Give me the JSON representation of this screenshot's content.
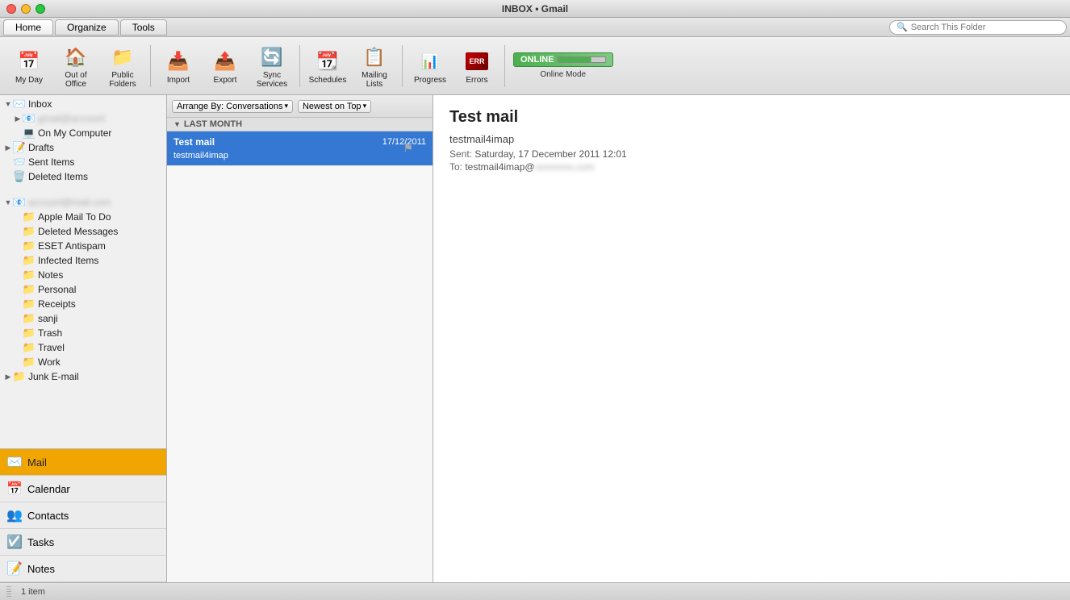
{
  "titleBar": {
    "title": "INBOX • Gmail"
  },
  "tabs": {
    "items": [
      "Home",
      "Organize",
      "Tools"
    ],
    "active": "Home"
  },
  "ribbon": {
    "buttons": [
      {
        "id": "my-day",
        "label": "My Day",
        "icon": "📅"
      },
      {
        "id": "out-of-office",
        "label": "Out of Office",
        "icon": "🏠"
      },
      {
        "id": "public-folders",
        "label": "Public Folders",
        "icon": "📁"
      },
      {
        "id": "import",
        "label": "Import",
        "icon": "📥"
      },
      {
        "id": "export",
        "label": "Export",
        "icon": "📤"
      },
      {
        "id": "sync-services",
        "label": "Sync Services",
        "icon": "🔄"
      },
      {
        "id": "schedules",
        "label": "Schedules",
        "icon": "📆"
      },
      {
        "id": "mailing-lists",
        "label": "Mailing Lists",
        "icon": "📋"
      },
      {
        "id": "progress",
        "label": "Progress",
        "icon": "📊"
      },
      {
        "id": "errors",
        "label": "Errors",
        "icon": "🖥️"
      }
    ],
    "onlineMode": {
      "label": "Online Mode",
      "status": "ONLINE"
    }
  },
  "sidebar": {
    "tree": [
      {
        "id": "inbox",
        "label": "Inbox",
        "level": 0,
        "expanded": true,
        "icon": "✉️",
        "hasArrow": true
      },
      {
        "id": "gmail-account",
        "label": "",
        "level": 1,
        "expanded": false,
        "icon": "📧",
        "hasArrow": true,
        "blurred": true
      },
      {
        "id": "on-my-computer",
        "label": "On My Computer",
        "level": 1,
        "expanded": false,
        "icon": "💻",
        "hasArrow": false
      },
      {
        "id": "drafts",
        "label": "Drafts",
        "level": 0,
        "expanded": false,
        "icon": "📝",
        "hasArrow": true
      },
      {
        "id": "sent-items",
        "label": "Sent Items",
        "level": 0,
        "expanded": false,
        "icon": "📨",
        "hasArrow": false
      },
      {
        "id": "deleted-items",
        "label": "Deleted Items",
        "level": 0,
        "expanded": false,
        "icon": "🗑️",
        "hasArrow": false
      },
      {
        "id": "spacer",
        "label": "",
        "level": 0,
        "expanded": false,
        "icon": "",
        "hasArrow": false,
        "spacer": true
      },
      {
        "id": "account2",
        "label": "",
        "level": 0,
        "expanded": true,
        "icon": "📧",
        "hasArrow": true,
        "blurred": true
      },
      {
        "id": "apple-mail",
        "label": "Apple Mail To Do",
        "level": 1,
        "expanded": false,
        "icon": "📁",
        "hasArrow": false
      },
      {
        "id": "deleted-messages",
        "label": "Deleted Messages",
        "level": 1,
        "expanded": false,
        "icon": "📁",
        "hasArrow": false
      },
      {
        "id": "eset-antispam",
        "label": "ESET Antispam",
        "level": 1,
        "expanded": false,
        "icon": "📁",
        "hasArrow": false
      },
      {
        "id": "infected-items",
        "label": "Infected Items",
        "level": 1,
        "expanded": false,
        "icon": "📁",
        "hasArrow": false
      },
      {
        "id": "notes",
        "label": "Notes",
        "level": 1,
        "expanded": false,
        "icon": "📁",
        "hasArrow": false
      },
      {
        "id": "personal",
        "label": "Personal",
        "level": 1,
        "expanded": false,
        "icon": "📁",
        "hasArrow": false
      },
      {
        "id": "receipts",
        "label": "Receipts",
        "level": 1,
        "expanded": false,
        "icon": "📁",
        "hasArrow": false
      },
      {
        "id": "sanji",
        "label": "sanji",
        "level": 1,
        "expanded": false,
        "icon": "📁",
        "hasArrow": false
      },
      {
        "id": "trash",
        "label": "Trash",
        "level": 1,
        "expanded": false,
        "icon": "📁",
        "hasArrow": false
      },
      {
        "id": "travel",
        "label": "Travel",
        "level": 1,
        "expanded": false,
        "icon": "📁",
        "hasArrow": false
      },
      {
        "id": "work",
        "label": "Work",
        "level": 1,
        "expanded": false,
        "icon": "📁",
        "hasArrow": false
      },
      {
        "id": "junk-email",
        "label": "Junk E-mail",
        "level": 0,
        "expanded": false,
        "icon": "📁",
        "hasArrow": true
      }
    ]
  },
  "navBar": {
    "items": [
      {
        "id": "mail",
        "label": "Mail",
        "icon": "✉️",
        "active": true
      },
      {
        "id": "calendar",
        "label": "Calendar",
        "icon": "📅",
        "active": false
      },
      {
        "id": "contacts",
        "label": "Contacts",
        "icon": "👥",
        "active": false
      },
      {
        "id": "tasks",
        "label": "Tasks",
        "icon": "☑️",
        "active": false
      },
      {
        "id": "notes",
        "label": "Notes",
        "icon": "📝",
        "active": false
      }
    ]
  },
  "messageList": {
    "arrangeBy": "Arrange By: Conversations",
    "sortBy": "Newest on Top",
    "groups": [
      {
        "id": "last-month",
        "label": "LAST MONTH",
        "messages": [
          {
            "id": "msg1",
            "subject": "Test mail",
            "from": "testmail4imap",
            "date": "17/12/2011",
            "selected": true,
            "flagged": true
          }
        ]
      }
    ]
  },
  "preview": {
    "subject": "Test mail",
    "from": "testmail4imap",
    "sent": "Saturday, 17 December 2011 12:01",
    "to": "testmail4imap@",
    "toBlurred": "gmail.com"
  },
  "search": {
    "placeholder": "Search This Folder"
  },
  "statusBar": {
    "itemCount": "1 item"
  }
}
